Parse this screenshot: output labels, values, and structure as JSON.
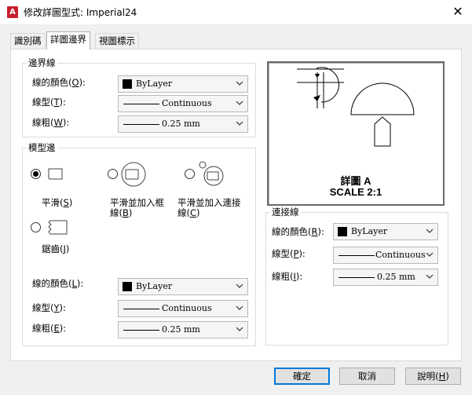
{
  "window": {
    "app_icon_letter": "A",
    "title": "修改詳圖型式: Imperial24",
    "close_glyph": "✕"
  },
  "tabs": [
    {
      "label": "識別碼"
    },
    {
      "label": "詳圖邊界"
    },
    {
      "label": "視圖標示"
    }
  ],
  "boundary": {
    "title": "邊界線",
    "color": {
      "label": "線的顏色",
      "key": "O",
      "value": "ByLayer"
    },
    "linetype": {
      "label": "線型",
      "key": "T",
      "value": "Continuous"
    },
    "lineweight": {
      "label": "線粗",
      "key": "W",
      "value": "0.25 mm"
    }
  },
  "model_edge": {
    "title": "模型邊",
    "smooth": {
      "label": "平滑",
      "key": "S",
      "selected": true
    },
    "smooth_border": {
      "label_1": "平滑並加入框",
      "label_2": "線",
      "key": "B",
      "selected": false
    },
    "smooth_connect": {
      "label_1": "平滑並加入連接",
      "label_2": "線",
      "key": "C",
      "selected": false
    },
    "jagged": {
      "label": "鋸齒",
      "key": "J",
      "selected": false
    },
    "color": {
      "label": "線的顏色",
      "key": "L",
      "value": "ByLayer"
    },
    "linetype": {
      "label": "線型",
      "key": "Y",
      "value": "Continuous"
    },
    "lineweight": {
      "label": "線粗",
      "key": "E",
      "value": "0.25 mm"
    }
  },
  "preview": {
    "line1": "詳圖 A",
    "line2": "SCALE 2:1"
  },
  "connection": {
    "title": "連接線",
    "color": {
      "label": "線的顏色",
      "key": "R",
      "value": "ByLayer"
    },
    "linetype": {
      "label": "線型",
      "key": "P",
      "value": "Continuous"
    },
    "lineweight": {
      "label": "線粗",
      "key": "I",
      "value": "0.25 mm"
    }
  },
  "buttons": {
    "ok": "確定",
    "cancel": "取消",
    "help": "說明",
    "help_key": "H"
  },
  "colors": {
    "accent": "#0078d7",
    "app_icon": "#c8202e"
  }
}
